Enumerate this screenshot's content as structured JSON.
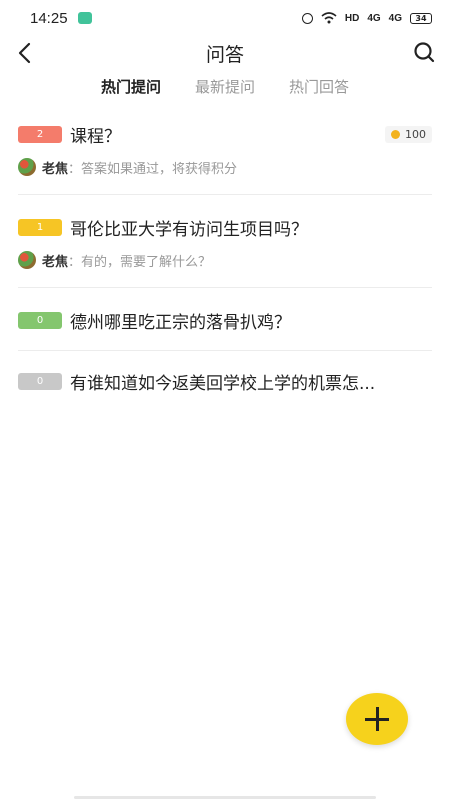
{
  "status": {
    "time": "14:25",
    "network": "HD",
    "signal1": "4G",
    "signal2": "4G",
    "battery": "34"
  },
  "nav": {
    "title": "问答"
  },
  "tabs": [
    {
      "label": "热门提问",
      "active": true
    },
    {
      "label": "最新提问",
      "active": false
    },
    {
      "label": "热门回答",
      "active": false
    }
  ],
  "questions": [
    {
      "count": "2",
      "badge_color": "#f47c6b",
      "title": "课程？",
      "reward": "100",
      "answerer": "老焦",
      "answer": "：答案如果通过，将获得积分"
    },
    {
      "count": "1",
      "badge_color": "#f6c525",
      "title": "哥伦比亚大学有访问生项目吗？",
      "answerer": "老焦",
      "answer": "：有的，需要了解什么？"
    },
    {
      "count": "0",
      "badge_color": "#84c66e",
      "title": "德州哪里吃正宗的落骨扒鸡？"
    },
    {
      "count": "0",
      "badge_color": "#c8c8c8",
      "title": "有谁知道如今返美回学校上学的机票怎..."
    }
  ],
  "fab": {
    "icon": "plus-icon"
  }
}
